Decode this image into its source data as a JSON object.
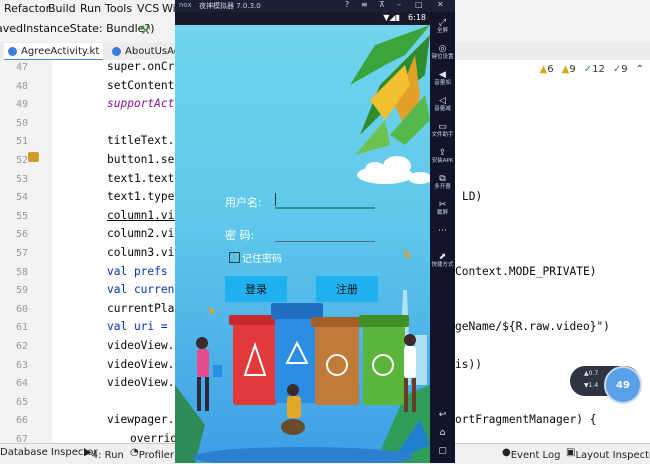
{
  "ide": {
    "menu": [
      "Refactor",
      "Build",
      "Run",
      "Tools",
      "VCS",
      "Wi"
    ],
    "crumb": "avedInstanceState: Bundle?)",
    "tabs": [
      {
        "label": "AgreeActivity.kt",
        "active": true
      },
      {
        "label": "AboutUsAc",
        "active": false
      }
    ],
    "inspections": {
      "warnings": "6",
      "weak_warnings": "9",
      "typos": "12",
      "info": "9"
    },
    "line_numbers": [
      "47",
      "48",
      "49",
      "50",
      "51",
      "52",
      "53",
      "54",
      "55",
      "56",
      "57",
      "58",
      "59",
      "60",
      "61",
      "62",
      "63",
      "64",
      "65",
      "66",
      "67"
    ],
    "code_lines": [
      {
        "a": "super.onCre",
        "b": ""
      },
      {
        "a": "setContentV",
        "b": ""
      },
      {
        "a": "supportActi",
        "b": ""
      },
      {
        "a": "",
        "b": ""
      },
      {
        "a": "titleText.",
        "b": ""
      },
      {
        "a": "button1.set",
        "b": ""
      },
      {
        "a": "text1.textS",
        "b": ""
      },
      {
        "a": "text1.typeF",
        "b": "LD)"
      },
      {
        "a": "column1.vis",
        "b": ""
      },
      {
        "a": "column2.vis",
        "b": ""
      },
      {
        "a": "column3.vis",
        "b": ""
      },
      {
        "a": "val prefs =",
        "b": "Context.MODE_PRIVATE)"
      },
      {
        "a": "val current",
        "b": ""
      },
      {
        "a": "currentPlac",
        "b": ""
      },
      {
        "a": "val uri = U",
        "b": "geName/${R.raw.video}\")"
      },
      {
        "a": "videoView.s",
        "b": ""
      },
      {
        "a": "videoView.s",
        "b": "is))"
      },
      {
        "a": "videoView.r",
        "b": ""
      },
      {
        "a": "",
        "b": ""
      },
      {
        "a": "viewpager.a",
        "b": "ortFragmentManager) {"
      },
      {
        "a": "override",
        "b": ""
      }
    ],
    "status_items": [
      "Database Inspector",
      "4: Run",
      "Profiler",
      "Event Log",
      "Layout Inspector"
    ]
  },
  "emulator": {
    "title": "夜神模拟器 7.0.3.0",
    "logo": "nox",
    "time": "6:18",
    "tools": [
      {
        "icon": "fullscreen-icon",
        "glyph": "⤢",
        "label": "全屏"
      },
      {
        "icon": "location-icon",
        "glyph": "◎",
        "label": "键位设置"
      },
      {
        "icon": "volume-up-icon",
        "glyph": "◀",
        "label": "音量加"
      },
      {
        "icon": "volume-down-icon",
        "glyph": "◁",
        "label": "音量减"
      },
      {
        "icon": "file-assistant-icon",
        "glyph": "▭",
        "label": "文件助手"
      },
      {
        "icon": "install-apk-icon",
        "glyph": "⇪",
        "label": "安装APK"
      },
      {
        "icon": "multi-instance-icon",
        "glyph": "⧉",
        "label": "多开器"
      },
      {
        "icon": "screenshot-icon",
        "glyph": "✂",
        "label": "截屏"
      },
      {
        "icon": "more-icon",
        "glyph": "⋯",
        "label": ""
      },
      {
        "icon": "shortcut-icon",
        "glyph": "⬈",
        "label": "快捷方式"
      }
    ],
    "nav": [
      {
        "icon": "back-icon",
        "glyph": "↩"
      },
      {
        "icon": "home-icon",
        "glyph": "⌂"
      },
      {
        "icon": "recent-apps-icon",
        "glyph": "▢"
      }
    ]
  },
  "app": {
    "username_label": "用户名:",
    "password_label": "密    码:",
    "remember_label": "记住密码",
    "login_button": "登录",
    "register_button": "注册"
  },
  "widget": {
    "percent": "49",
    "up": "0.7",
    "down": "1.4"
  },
  "colors": {
    "accent_button": "#1fb1f0",
    "screen_top": "#70d4ec",
    "screen_bottom": "#3d9ee6",
    "emulator_frame": "#0d0f1d"
  }
}
